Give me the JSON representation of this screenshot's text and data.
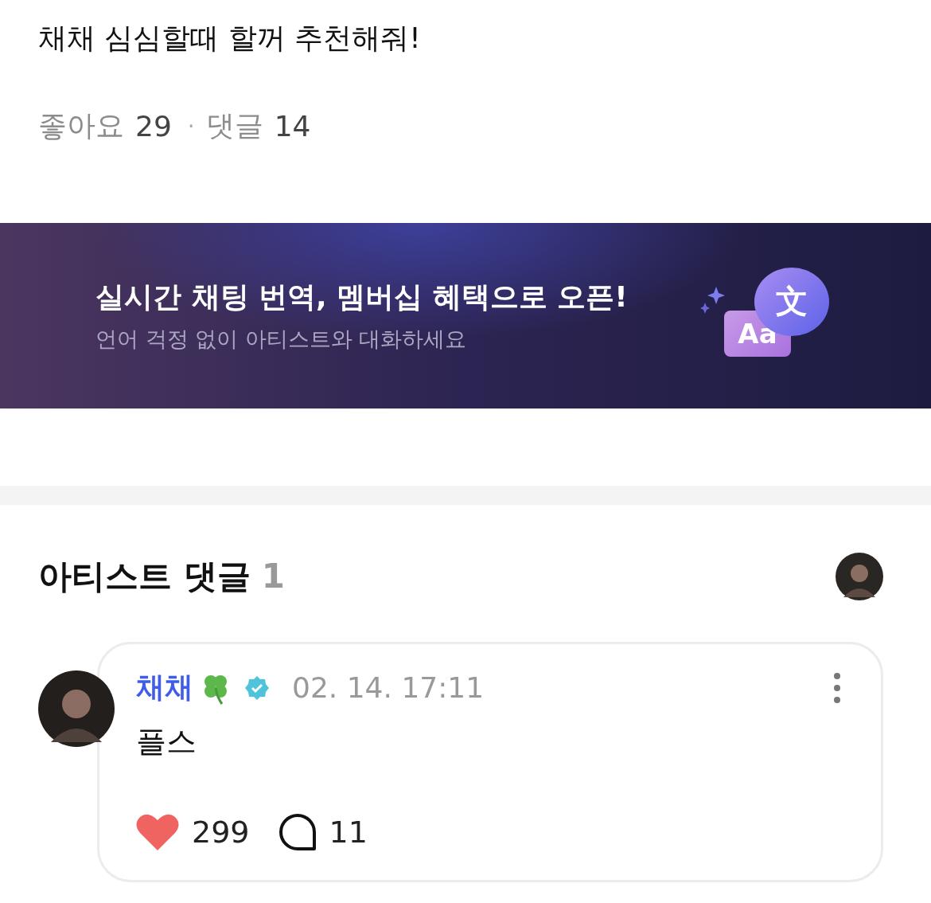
{
  "post": {
    "title": "채채 심심할때 할꺼 추천해줘!",
    "like_label": "좋아요",
    "like_count": "29",
    "separator": "·",
    "comment_label": "댓글",
    "comment_count": "14"
  },
  "banner": {
    "title": "실시간 채팅 번역, 멤버십 혜택으로 오픈!",
    "subtitle": "언어 걱정 없이 아티스트와 대화하세요",
    "glyph_back": "Aa",
    "glyph_front": "文"
  },
  "artist_comments": {
    "heading": "아티스트 댓글",
    "count": "1",
    "comments": [
      {
        "author": "채채",
        "verified": true,
        "time": "02. 14. 17:11",
        "text": "플스",
        "likes": "299",
        "replies": "11"
      }
    ]
  }
}
